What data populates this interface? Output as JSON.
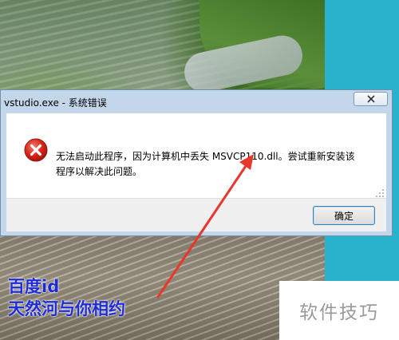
{
  "dialog": {
    "title": "vstudio.exe - 系统错误",
    "message_line1": "无法启动此程序，因为计算机中丢失 MSVCP110.dll。尝试重新安装该",
    "message_line2": "程序以解决此问题。",
    "ok_label": "确定",
    "icon": "error-icon",
    "close_icon": "close-icon"
  },
  "annotation": {
    "arrow_color": "#e8372c"
  },
  "watermarks": {
    "left_line1": "百度id",
    "left_line2": "天然河与你相约",
    "right_text": "软件技巧"
  }
}
